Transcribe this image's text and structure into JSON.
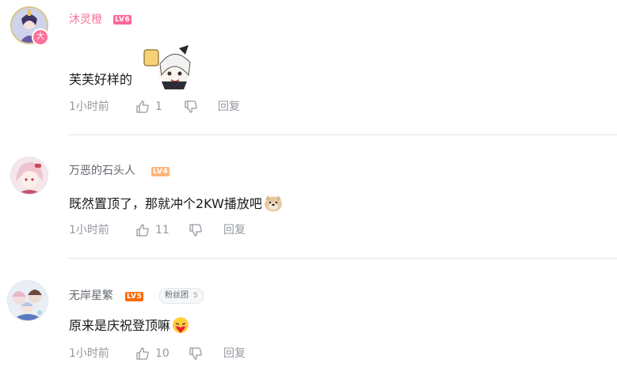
{
  "comments": [
    {
      "username": "沐灵橙",
      "level": "LV6",
      "level_color": "#ff6699",
      "avatar_badge": "大",
      "content": "芙芙好样的",
      "time": "1小时前",
      "likes": "1",
      "reply_label": "回复"
    },
    {
      "username": "万恶的石头人",
      "level": "LV4",
      "level_color": "#ffb37c",
      "content": "既然置顶了，那就冲个2KW播放吧",
      "time": "1小时前",
      "likes": "11",
      "reply_label": "回复"
    },
    {
      "username": "无岸星繁",
      "level": "LV5",
      "level_color": "#ff6c00",
      "fan_badge": "粉丝团",
      "fan_badge_level": "5",
      "content": "原来是庆祝登顶嘛",
      "time": "1小时前",
      "likes": "10",
      "reply_label": "回复"
    }
  ]
}
